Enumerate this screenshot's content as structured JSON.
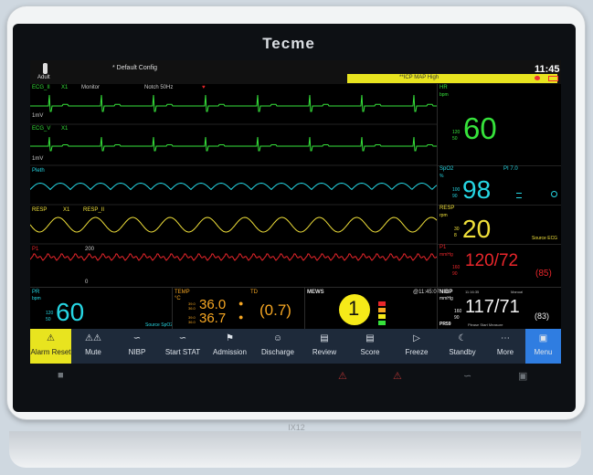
{
  "brand": "Tecme",
  "model": "IX12",
  "header": {
    "patient_type": "Adult",
    "config": "* Default Config",
    "alarm": "**ICP MAP High",
    "time": "11:45"
  },
  "waves": {
    "ecg2": {
      "label": "ECG_II",
      "gain": "X1",
      "mode": "Monitor",
      "filter": "Notch 50Hz",
      "scale": "1mV"
    },
    "ecgv": {
      "label": "ECG_V",
      "gain": "X1",
      "scale": "1mV"
    },
    "pleth": {
      "label": "Pleth"
    },
    "resp": {
      "label": "RESP",
      "gain": "X1",
      "lead": "RESP_II"
    },
    "p1": {
      "label": "P1",
      "top": "200",
      "bottom": "0"
    }
  },
  "params": {
    "hr": {
      "label": "HR",
      "unit": "bpm",
      "value": "60",
      "hi": "120",
      "lo": "50"
    },
    "spo2": {
      "label": "SpO2",
      "unit": "%",
      "pi": "PI 7.0",
      "value": "98",
      "hi": "100",
      "lo": "90"
    },
    "resp": {
      "label": "RESP",
      "unit": "rpm",
      "value": "20",
      "hi": "30",
      "lo": "8",
      "source": "Source ECG"
    },
    "p1": {
      "label": "P1",
      "unit": "mmHg",
      "value": "120/72",
      "mean": "(85)",
      "hi": "160",
      "lo": "90"
    },
    "pr": {
      "label": "PR",
      "unit": "bpm",
      "value": "60",
      "hi": "120",
      "lo": "50",
      "source": "Source SpO2"
    },
    "temp": {
      "label": "TEMP",
      "unit": "°C",
      "t1": "36.0",
      "t2": "36.7",
      "lim_hi": "39.0",
      "lim_lo": "36.0",
      "td_label": "TD",
      "td": "(0.7)"
    },
    "mews": {
      "label": "MEWS",
      "score": "1",
      "time": "@11:45:07"
    },
    "nibp": {
      "label": "NIBP",
      "unit": "mmHg",
      "time": "11:16:35",
      "mode": "Manual",
      "value": "117/71",
      "mean": "(83)",
      "hi": "160",
      "lo": "90",
      "pr": "PR59",
      "status": "Please Start Measure"
    }
  },
  "softkeys": [
    "Alarm Reset",
    "Mute",
    "NIBP",
    "Start STAT",
    "Admission",
    "Discharge",
    "Review",
    "Score",
    "Freeze",
    "Standby",
    "More",
    "Menu"
  ],
  "colors": {
    "hr": "#36e23b",
    "spo2": "#26d6e3",
    "resp": "#f0e03a",
    "ibp": "#e8262b",
    "temp": "#f5a623",
    "alarm_bar": "#e8e41f",
    "menu_key": "#2f7de1"
  }
}
